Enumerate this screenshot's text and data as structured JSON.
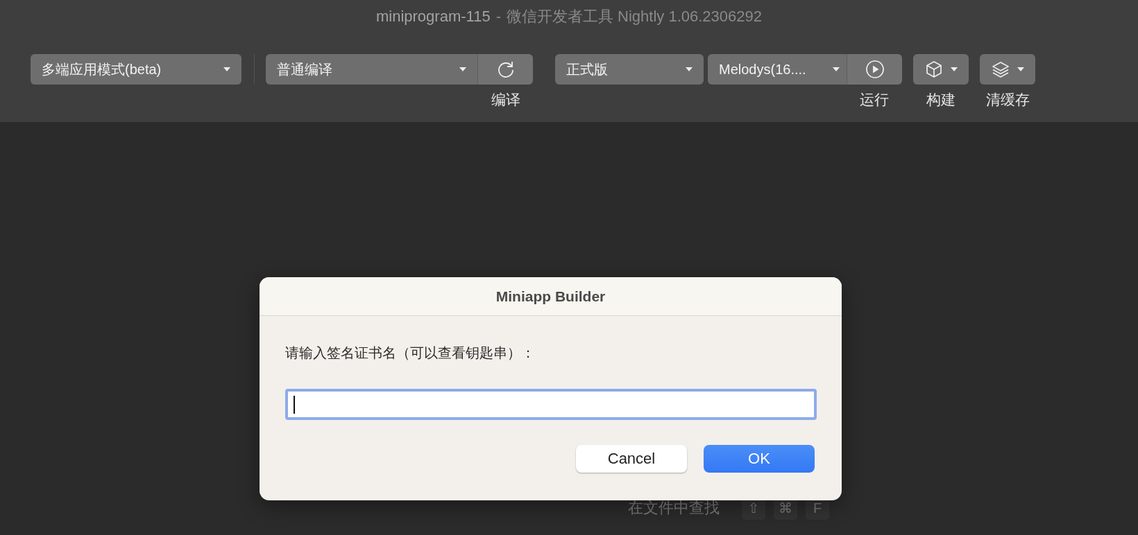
{
  "window": {
    "title": "miniprogram-115",
    "separator": "-",
    "subtitle": "微信开发者工具 Nightly 1.06.2306292"
  },
  "toolbar": {
    "mode_select": "多端应用模式(beta)",
    "compile_select": "普通编译",
    "compile_label": "编译",
    "version_select": "正式版",
    "account_select": "Melodys(16....",
    "run_label": "运行",
    "build_label": "构建",
    "clear_cache_label": "清缓存"
  },
  "background_hint": {
    "label": "在文件中查找",
    "keys": [
      "⇧",
      "⌘",
      "F"
    ]
  },
  "dialog": {
    "title": "Miniapp Builder",
    "prompt": "请输入签名证书名（可以查看钥匙串）：",
    "input_focused": true,
    "buttons": [
      {
        "label": "Cancel",
        "kind": "secondary"
      },
      {
        "label": "OK",
        "kind": "default"
      }
    ]
  }
}
